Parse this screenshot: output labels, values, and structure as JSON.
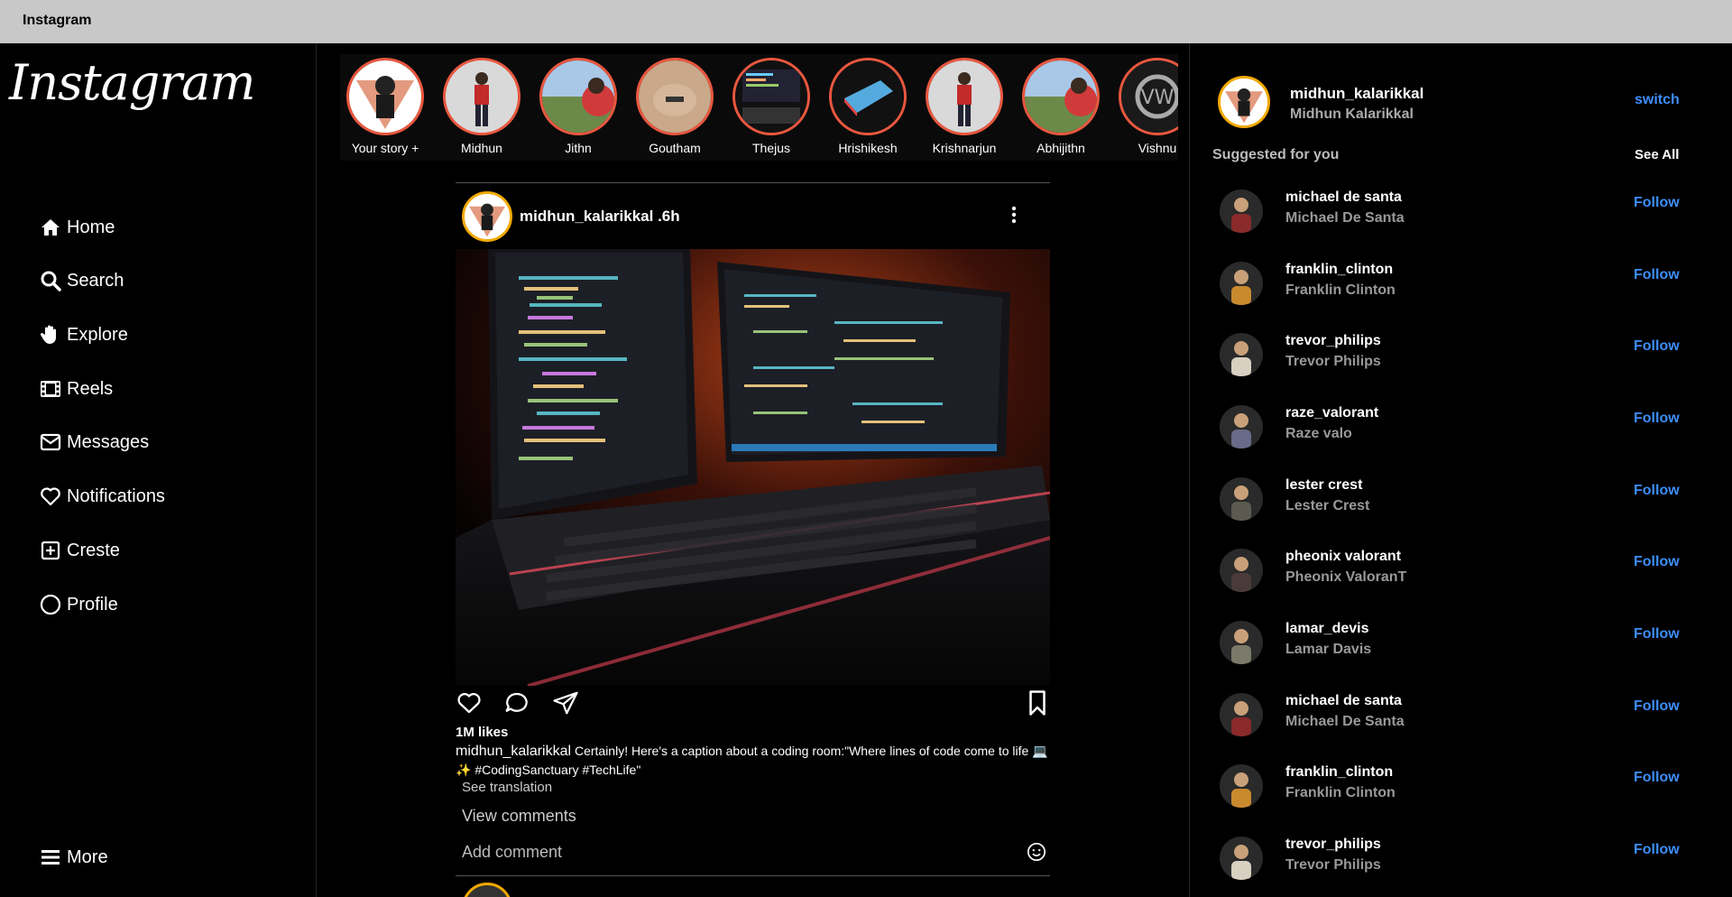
{
  "window": {
    "title": "Instagram"
  },
  "logo": {
    "text": "Instagram"
  },
  "nav": [
    {
      "label": "Home",
      "icon": "home-icon"
    },
    {
      "label": "Search",
      "icon": "search-icon"
    },
    {
      "label": "Explore",
      "icon": "explore-icon"
    },
    {
      "label": "Reels",
      "icon": "reels-icon"
    },
    {
      "label": "Messages",
      "icon": "envelope-icon"
    },
    {
      "label": "Notifications",
      "icon": "heart-icon"
    },
    {
      "label": "Creste",
      "icon": "plus-square-icon"
    },
    {
      "label": "Profile",
      "icon": "circle-icon"
    }
  ],
  "more": {
    "label": "More",
    "icon": "hamburger-icon"
  },
  "stories": [
    {
      "name": "Your story +"
    },
    {
      "name": "Midhun"
    },
    {
      "name": "Jithn"
    },
    {
      "name": "Goutham"
    },
    {
      "name": "Thejus"
    },
    {
      "name": "Hrishikesh"
    },
    {
      "name": "Krishnarjun"
    },
    {
      "name": "Abhijithn"
    },
    {
      "name": "Vishnu"
    }
  ],
  "post": {
    "username": "midhun_kalarikkal .6h",
    "likes": "1M likes",
    "caption_user": "midhun_kalarikkal",
    "caption_text": "Certainly! Here's a caption about a coding room:\"Where lines of code come to life 💻✨ #CodingSanctuary #TechLife\"",
    "see_translation": "See translation",
    "view_comments": "View comments",
    "add_comment": "Add comment"
  },
  "me": {
    "username": "midhun_kalarikkal",
    "fullname": "Midhun Kalarikkal",
    "switch_label": "switch"
  },
  "suggested": {
    "heading": "Suggested for you",
    "see_all": "See All",
    "follow_label": "Follow",
    "items": [
      {
        "username": "michael de santa",
        "fullname": "Michael De Santa",
        "color": "#8a2a2a"
      },
      {
        "username": "franklin_clinton",
        "fullname": "Franklin Clinton",
        "color": "#c98a2e"
      },
      {
        "username": "trevor_philips",
        "fullname": "Trevor Philips",
        "color": "#d8d0c0"
      },
      {
        "username": "raze_valorant",
        "fullname": "Raze valo",
        "color": "#6a6a8a"
      },
      {
        "username": "lester crest",
        "fullname": "Lester Crest",
        "color": "#5a5a50"
      },
      {
        "username": "pheonix valorant",
        "fullname": "Pheonix ValoranT",
        "color": "#4a3a3a"
      },
      {
        "username": "lamar_devis",
        "fullname": "Lamar Davis",
        "color": "#7a7a6a"
      },
      {
        "username": "michael de santa",
        "fullname": "Michael De Santa",
        "color": "#8a2a2a"
      },
      {
        "username": "franklin_clinton",
        "fullname": "Franklin Clinton",
        "color": "#c98a2e"
      },
      {
        "username": "trevor_philips",
        "fullname": "Trevor Philips",
        "color": "#d8d0c0"
      }
    ]
  },
  "colors": {
    "accent": "#3d8ef8",
    "story_ring": "#e9573f",
    "avatar_ring": "#f2a900"
  }
}
